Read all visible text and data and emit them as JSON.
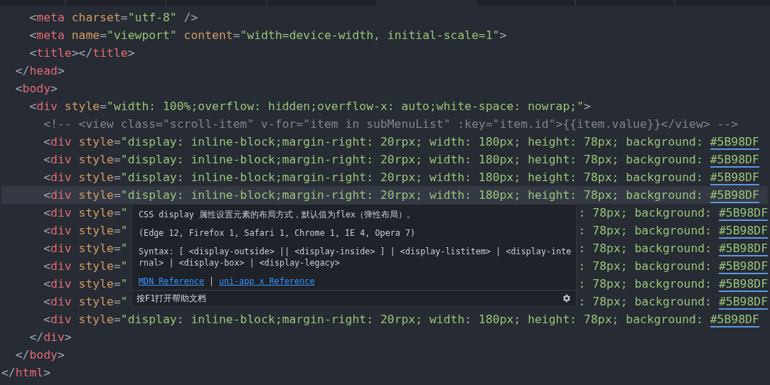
{
  "lines": [
    {
      "kind": "full",
      "current": false,
      "tokens": [
        {
          "kind": "punct",
          "text": "    <"
        },
        {
          "kind": "tag",
          "text": "meta"
        },
        {
          "kind": "attr",
          "text": " charset"
        },
        {
          "kind": "punct",
          "text": "="
        },
        {
          "kind": "string",
          "text": "\"utf-8\""
        },
        {
          "kind": "punct",
          "text": " />"
        }
      ]
    },
    {
      "kind": "full",
      "current": false,
      "tokens": [
        {
          "kind": "punct",
          "text": "    <"
        },
        {
          "kind": "tag",
          "text": "meta"
        },
        {
          "kind": "attr",
          "text": " name"
        },
        {
          "kind": "punct",
          "text": "="
        },
        {
          "kind": "string",
          "text": "\"viewport\""
        },
        {
          "kind": "attr",
          "text": " content"
        },
        {
          "kind": "punct",
          "text": "="
        },
        {
          "kind": "string",
          "text": "\"width=device-width, initial-scale=1\""
        },
        {
          "kind": "punct",
          "text": ">"
        }
      ]
    },
    {
      "kind": "full",
      "current": false,
      "tokens": [
        {
          "kind": "punct",
          "text": "    <"
        },
        {
          "kind": "tag",
          "text": "title"
        },
        {
          "kind": "punct",
          "text": "></"
        },
        {
          "kind": "tag",
          "text": "title"
        },
        {
          "kind": "punct",
          "text": ">"
        }
      ]
    },
    {
      "kind": "full",
      "current": false,
      "tokens": [
        {
          "kind": "punct",
          "text": "  </"
        },
        {
          "kind": "tag",
          "text": "head"
        },
        {
          "kind": "punct",
          "text": ">"
        }
      ]
    },
    {
      "kind": "full",
      "current": false,
      "tokens": [
        {
          "kind": "punct",
          "text": "  <"
        },
        {
          "kind": "tag",
          "text": "body"
        },
        {
          "kind": "punct",
          "text": ">"
        }
      ]
    },
    {
      "kind": "full",
      "current": false,
      "tokens": [
        {
          "kind": "punct",
          "text": "    <"
        },
        {
          "kind": "tag",
          "text": "div"
        },
        {
          "kind": "attr",
          "text": " style"
        },
        {
          "kind": "punct",
          "text": "="
        },
        {
          "kind": "string",
          "text": "\"width: 100%;overflow: hidden;overflow-x: auto;white-space: nowrap;\""
        },
        {
          "kind": "punct",
          "text": ">"
        }
      ]
    },
    {
      "kind": "full",
      "current": false,
      "tokens": [
        {
          "kind": "comment",
          "text": "      <!-- <view class=\"scroll-item\" v-for=\"item in subMenuList\" :key=\"item.id\">{{item.value}}</view> -->"
        }
      ]
    },
    {
      "kind": "full",
      "current": false,
      "tokens": [
        {
          "kind": "punct",
          "text": "      <"
        },
        {
          "kind": "tag",
          "text": "div"
        },
        {
          "kind": "attr",
          "text": " style"
        },
        {
          "kind": "punct",
          "text": "="
        },
        {
          "kind": "string",
          "text": "\"display: inline-block;margin-right: 20rpx; width: 180px; height: 78px; background: "
        },
        {
          "kind": "swatch",
          "text": "#5B98DF"
        }
      ]
    },
    {
      "kind": "full",
      "current": false,
      "tokens": [
        {
          "kind": "punct",
          "text": "      <"
        },
        {
          "kind": "tag",
          "text": "div"
        },
        {
          "kind": "attr",
          "text": " style"
        },
        {
          "kind": "punct",
          "text": "="
        },
        {
          "kind": "string",
          "text": "\"display: inline-block;margin-right: 20rpx; width: 180px; height: 78px; background: "
        },
        {
          "kind": "swatch",
          "text": "#5B98DF"
        }
      ]
    },
    {
      "kind": "full",
      "current": false,
      "tokens": [
        {
          "kind": "punct",
          "text": "      <"
        },
        {
          "kind": "tag",
          "text": "div"
        },
        {
          "kind": "attr",
          "text": " style"
        },
        {
          "kind": "punct",
          "text": "="
        },
        {
          "kind": "string",
          "text": "\"display: inline-block;margin-right: 20rpx; width: 180px; height: 78px; background: "
        },
        {
          "kind": "swatch",
          "text": "#5B98DF"
        }
      ]
    },
    {
      "kind": "full",
      "current": true,
      "tokens": [
        {
          "kind": "punct",
          "text": "      <"
        },
        {
          "kind": "tag",
          "text": "div"
        },
        {
          "kind": "attr",
          "text": " style"
        },
        {
          "kind": "punct",
          "text": "="
        },
        {
          "kind": "string",
          "text": "\"display: inline-block;margin-right: 20rpx; width: 180px; height: 78px; background: "
        },
        {
          "kind": "swatch",
          "text": "#5B98DF"
        }
      ]
    },
    {
      "kind": "split",
      "current": false,
      "left": [
        {
          "kind": "punct",
          "text": "      <"
        },
        {
          "kind": "tag",
          "text": "div"
        },
        {
          "kind": "attr",
          "text": " style"
        },
        {
          "kind": "punct",
          "text": "="
        },
        {
          "kind": "string",
          "text": "\""
        }
      ],
      "right": [
        {
          "kind": "string",
          "text": ": 78px; background: "
        },
        {
          "kind": "swatch",
          "text": "#5B98DF"
        }
      ]
    },
    {
      "kind": "split",
      "current": false,
      "left": [
        {
          "kind": "punct",
          "text": "      <"
        },
        {
          "kind": "tag",
          "text": "div"
        },
        {
          "kind": "attr",
          "text": " style"
        },
        {
          "kind": "punct",
          "text": "="
        },
        {
          "kind": "string",
          "text": "\""
        }
      ],
      "right": [
        {
          "kind": "string",
          "text": ": 78px; background: "
        },
        {
          "kind": "swatch",
          "text": "#5B98DF"
        }
      ]
    },
    {
      "kind": "split",
      "current": false,
      "left": [
        {
          "kind": "punct",
          "text": "      <"
        },
        {
          "kind": "tag",
          "text": "div"
        },
        {
          "kind": "attr",
          "text": " style"
        },
        {
          "kind": "punct",
          "text": "="
        },
        {
          "kind": "string",
          "text": "\""
        }
      ],
      "right": [
        {
          "kind": "string",
          "text": ": 78px; background: "
        },
        {
          "kind": "swatch",
          "text": "#5B98DF"
        }
      ]
    },
    {
      "kind": "split",
      "current": false,
      "left": [
        {
          "kind": "punct",
          "text": "      <"
        },
        {
          "kind": "tag",
          "text": "div"
        },
        {
          "kind": "attr",
          "text": " style"
        },
        {
          "kind": "punct",
          "text": "="
        },
        {
          "kind": "string",
          "text": "\""
        }
      ],
      "right": [
        {
          "kind": "string",
          "text": ": 78px; background: "
        },
        {
          "kind": "swatch",
          "text": "#5B98DF"
        }
      ]
    },
    {
      "kind": "split",
      "current": false,
      "left": [
        {
          "kind": "punct",
          "text": "      <"
        },
        {
          "kind": "tag",
          "text": "div"
        },
        {
          "kind": "attr",
          "text": " style"
        },
        {
          "kind": "punct",
          "text": "="
        },
        {
          "kind": "string",
          "text": "\""
        }
      ],
      "right": [
        {
          "kind": "string",
          "text": ": 78px; background: "
        },
        {
          "kind": "swatch",
          "text": "#5B98DF"
        }
      ]
    },
    {
      "kind": "split",
      "current": false,
      "left": [
        {
          "kind": "punct",
          "text": "      <"
        },
        {
          "kind": "tag",
          "text": "div"
        },
        {
          "kind": "attr",
          "text": " style"
        },
        {
          "kind": "punct",
          "text": "="
        },
        {
          "kind": "string",
          "text": "\""
        }
      ],
      "right": [
        {
          "kind": "string",
          "text": ": 78px; background: "
        },
        {
          "kind": "swatch",
          "text": "#5B98DF"
        }
      ]
    },
    {
      "kind": "full",
      "current": false,
      "tokens": [
        {
          "kind": "punct",
          "text": "      <"
        },
        {
          "kind": "tag",
          "text": "div"
        },
        {
          "kind": "attr",
          "text": " style"
        },
        {
          "kind": "punct",
          "text": "="
        },
        {
          "kind": "string",
          "text": "\"display: inline-block;margin-right: 20rpx; width: 180px; height: 78px; background: "
        },
        {
          "kind": "swatch",
          "text": "#5B98DF"
        }
      ]
    },
    {
      "kind": "full",
      "current": false,
      "tokens": [
        {
          "kind": "punct",
          "text": "    </"
        },
        {
          "kind": "tag",
          "text": "div"
        },
        {
          "kind": "punct",
          "text": ">"
        }
      ]
    },
    {
      "kind": "full",
      "current": false,
      "tokens": [
        {
          "kind": "punct",
          "text": "  </"
        },
        {
          "kind": "tag",
          "text": "body"
        },
        {
          "kind": "punct",
          "text": ">"
        }
      ]
    },
    {
      "kind": "full",
      "current": false,
      "tokens": [
        {
          "kind": "punct",
          "text": "</"
        },
        {
          "kind": "tag",
          "text": "html"
        },
        {
          "kind": "punct",
          "text": ">"
        }
      ]
    }
  ],
  "hover_tooltip": {
    "description": "CSS display 属性设置元素的布局方式，默认值为flex（弹性布局）。",
    "compatibility": "(Edge 12, Firefox 1, Safari 1, Chrome 1, IE 4, Opera 7)",
    "syntax": "Syntax: [ <display-outside> || <display-inside> ] | <display-listitem> | <display-internal> | <display-box> | <display-legacy>",
    "links": [
      "MDN Reference",
      "uni-app x Reference"
    ],
    "separator": "|",
    "footer": "按F1打开帮助文档"
  }
}
